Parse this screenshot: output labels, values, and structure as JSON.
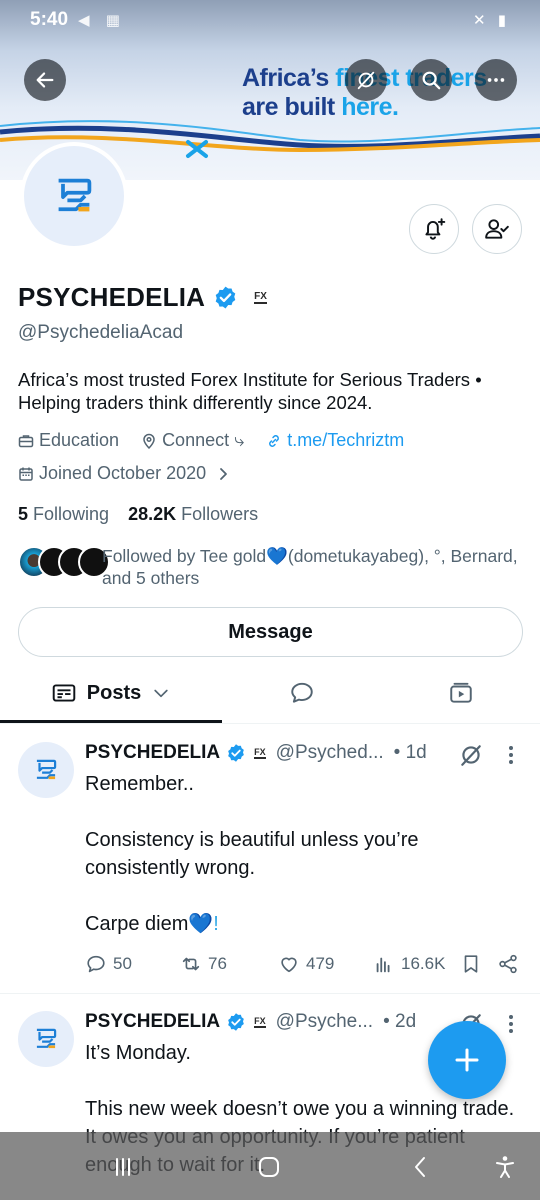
{
  "status_bar": {
    "time": "5:40",
    "left_icons": "◀ ▦",
    "right_icons": "✕ ▮"
  },
  "banner": {
    "line1_a": "Africa’s ",
    "line1_b": "finest traders",
    "line2_a": "are built ",
    "line2_b": "here."
  },
  "header_buttons": {
    "back": "back-arrow-icon",
    "grok": "grok-icon",
    "search": "search-icon",
    "more": "more-icon"
  },
  "profile": {
    "name": "PSYCHEDELIA",
    "badge": "FX",
    "handle": "@PsychedeliaAcad",
    "bio": "Africa’s most trusted Forex Institute for Serious Traders • Helping traders think differently since 2024.",
    "category": "Education",
    "location": "Connect ⤷",
    "link": "t.me/Techriztm",
    "joined": "Joined October 2020",
    "following_count": "5",
    "following_label": "Following",
    "followers_count": "28.2K",
    "followers_label": "Followers",
    "followed_by": "Followed by Tee gold💙(dometukayabeg), °, Bernard, and 5 others",
    "message_label": "Message"
  },
  "tabs": {
    "posts_label": "Posts"
  },
  "posts": [
    {
      "name": "PSYCHEDELIA",
      "badge": "FX",
      "handle": "@Psyched...",
      "time": "• 1d",
      "lines": [
        "Remember..",
        "Consistency is beautiful unless you’re consistently wrong.",
        "Carpe diem"
      ],
      "heart": "💙!",
      "replies": "50",
      "reposts": "76",
      "likes": "479",
      "views": "16.6K"
    },
    {
      "name": "PSYCHEDELIA",
      "badge": "FX",
      "handle": "@Psyche...",
      "time": "• 2d",
      "lines": [
        "It’s Monday.",
        "This new week doesn’t owe you a winning trade. It owes you an opportunity. If you’re patient enough to wait for it."
      ]
    }
  ],
  "colors": {
    "accent": "#1d9bf0",
    "text": "#0f1419",
    "muted": "#536471",
    "border": "#cfd9de"
  }
}
